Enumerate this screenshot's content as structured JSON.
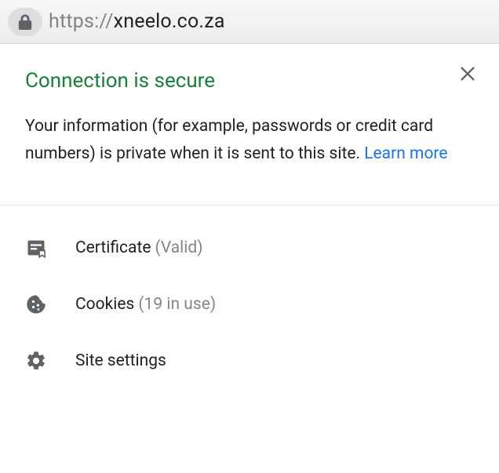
{
  "address_bar": {
    "protocol": "https://",
    "host": "xneelo.co.za"
  },
  "popup": {
    "title": "Connection is secure",
    "description": "Your information (for example, passwords or credit card numbers) is private when it is sent to this site. ",
    "learn_more": "Learn more",
    "menu": {
      "certificate": {
        "label": "Certificate",
        "sub": "(Valid)"
      },
      "cookies": {
        "label": "Cookies",
        "sub": "(19 in use)"
      },
      "settings": {
        "label": "Site settings"
      }
    }
  },
  "colors": {
    "accent_green": "#188038",
    "link_blue": "#1a73e8",
    "text_muted": "#80868b"
  }
}
